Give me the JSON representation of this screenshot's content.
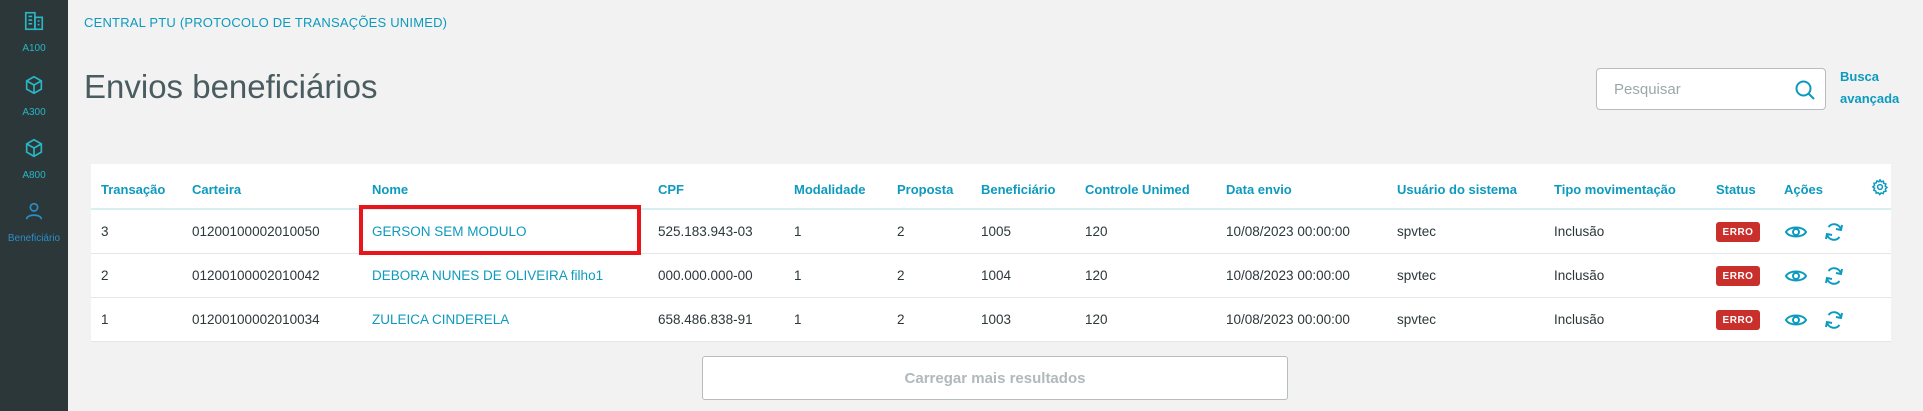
{
  "sidebar": {
    "items": [
      {
        "label": "A100",
        "icon": "building-icon"
      },
      {
        "label": "A300",
        "icon": "cube-icon"
      },
      {
        "label": "A800",
        "icon": "cube-icon"
      },
      {
        "label": "Beneficiário",
        "icon": "user-icon"
      }
    ]
  },
  "header": {
    "breadcrumb": "CENTRAL PTU (PROTOCOLO DE TRANSAÇÕES UNIMED)",
    "title": "Envios beneficiários"
  },
  "search": {
    "placeholder": "Pesquisar",
    "advanced_line1": "Busca",
    "advanced_line2": "avançada"
  },
  "table": {
    "columns": [
      "Transação",
      "Carteira",
      "Nome",
      "CPF",
      "Modalidade",
      "Proposta",
      "Beneficiário",
      "Controle Unimed",
      "Data envio",
      "Usuário do sistema",
      "Tipo movimentação",
      "Status",
      "Ações"
    ],
    "rows": [
      {
        "transacao": "3",
        "carteira": "01200100002010050",
        "nome": "GERSON SEM MODULO",
        "cpf": "525.183.943-03",
        "modalidade": "1",
        "proposta": "2",
        "beneficiario": "1005",
        "controle": "120",
        "data_envio": "10/08/2023 00:00:00",
        "usuario": "spvtec",
        "tipo": "Inclusão",
        "status": "ERRO"
      },
      {
        "transacao": "2",
        "carteira": "01200100002010042",
        "nome": "DEBORA NUNES DE OLIVEIRA filho1",
        "cpf": "000.000.000-00",
        "modalidade": "1",
        "proposta": "2",
        "beneficiario": "1004",
        "controle": "120",
        "data_envio": "10/08/2023 00:00:00",
        "usuario": "spvtec",
        "tipo": "Inclusão",
        "status": "ERRO"
      },
      {
        "transacao": "1",
        "carteira": "01200100002010034",
        "nome": "ZULEICA CINDERELA",
        "cpf": "658.486.838-91",
        "modalidade": "1",
        "proposta": "2",
        "beneficiario": "1003",
        "controle": "120",
        "data_envio": "10/08/2023 00:00:00",
        "usuario": "spvtec",
        "tipo": "Inclusão",
        "status": "ERRO"
      }
    ]
  },
  "load_more": "Carregar mais resultados",
  "colors": {
    "accent": "#0c9abe",
    "sidebar_bg": "#2c3739",
    "error": "#c9302c",
    "highlight": "#e8151b"
  }
}
